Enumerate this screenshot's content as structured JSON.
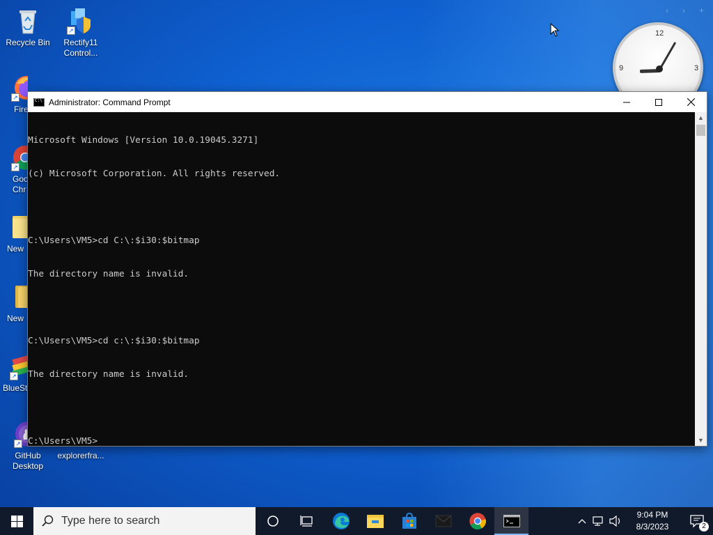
{
  "desktop": {
    "icons": [
      {
        "label": "Recycle Bin"
      },
      {
        "label": "Rectify11 Control..."
      },
      {
        "label": "Fire"
      },
      {
        "label": "Goo Chr"
      },
      {
        "label": "New"
      },
      {
        "label": "New"
      },
      {
        "label": "BlueSt"
      },
      {
        "label": "GitHub Desktop"
      },
      {
        "label": "explorerfra..."
      }
    ]
  },
  "clock_gadget": {
    "numerals": [
      "12",
      "3",
      "9"
    ]
  },
  "window": {
    "title": "Administrator:  Command Prompt",
    "console_lines": [
      "Microsoft Windows [Version 10.0.19045.3271]",
      "(c) Microsoft Corporation. All rights reserved.",
      "",
      "C:\\Users\\VM5>cd C:\\:$i30:$bitmap",
      "The directory name is invalid.",
      "",
      "C:\\Users\\VM5>cd c:\\:$i30:$bitmap",
      "The directory name is invalid.",
      "",
      "C:\\Users\\VM5>"
    ]
  },
  "taskbar": {
    "search_placeholder": "Type here to search",
    "time": "9:04 PM",
    "date": "8/3/2023",
    "notification_count": "2"
  },
  "colors": {
    "console_bg": "#0c0c0c",
    "console_fg": "#cccccc",
    "taskbar_bg": "#101a2b",
    "accent": "#0e5fcf"
  }
}
